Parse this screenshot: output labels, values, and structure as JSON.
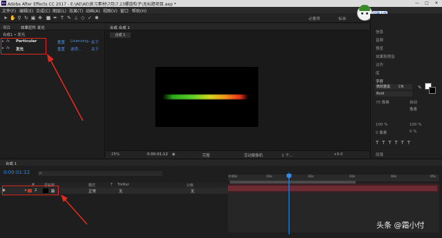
{
  "app": {
    "title": "Adobe After Effects CC 2017 - E:\\AE\\AE\\练习素材\\7月\\7.23螺旋粒子\\无标题项目.aep *",
    "icon": "Ae"
  },
  "menu": [
    "文件(F)",
    "编辑(E)",
    "合成(C)",
    "图层(L)",
    "效果(T)",
    "动画(A)",
    "视图(V)",
    "窗口",
    "帮助(H)"
  ],
  "workspaces": [
    "必要项",
    "标准",
    "小屏幕"
  ],
  "popup_label": "切换上传",
  "left_panel": {
    "tabs": [
      "项目",
      "效果控件 发光"
    ],
    "breadcrumb": "合成1 • 发光",
    "effects": [
      {
        "name": "Particular",
        "reset": "重置",
        "extra": "Licensing...",
        "about": "关于"
      },
      {
        "name": "发光",
        "reset": "重置",
        "extra": "选项...",
        "about": "关于"
      }
    ]
  },
  "viewer": {
    "tab": "合成 合成 1",
    "sub_tab": "合成 1",
    "zoom": "25%",
    "timecode": "0:00:01:12",
    "quality": "完整",
    "camera": "活动摄像机",
    "views": "1 个...",
    "offset": "+0.0"
  },
  "right_panel": {
    "items": [
      "信息",
      "音频",
      "预览",
      "效果和预设",
      "对齐",
      "库",
      "字符",
      "段落"
    ],
    "font": "微软雅黑",
    "font_lang": "CN",
    "style": "Bold",
    "font_size": "75 像素",
    "leading": "自动",
    "unit": "像素",
    "scale_v": "100 %",
    "scale_h": "100 %",
    "baseline": "0 像素",
    "tsume": "0 %"
  },
  "timeline": {
    "tab": "合成 1",
    "timecode": "0:00:01:12",
    "search_placeholder": "ρ.",
    "columns": [
      "#",
      "源名称",
      "模式",
      "T",
      "TrkMat",
      "父级"
    ],
    "layers": [
      {
        "num": "2",
        "name": "新",
        "mode": "正常",
        "trkmat": "无",
        "parent": "无"
      }
    ],
    "ruler_labels": [
      "0:00s",
      "01s",
      "02s",
      "03s",
      "04s",
      "05s"
    ]
  },
  "watermark": "头条 @霜小付",
  "colors": {
    "accent": "#2d8ceb",
    "highlight": "#e32a1f",
    "layer_bar": "#6b2b30"
  }
}
